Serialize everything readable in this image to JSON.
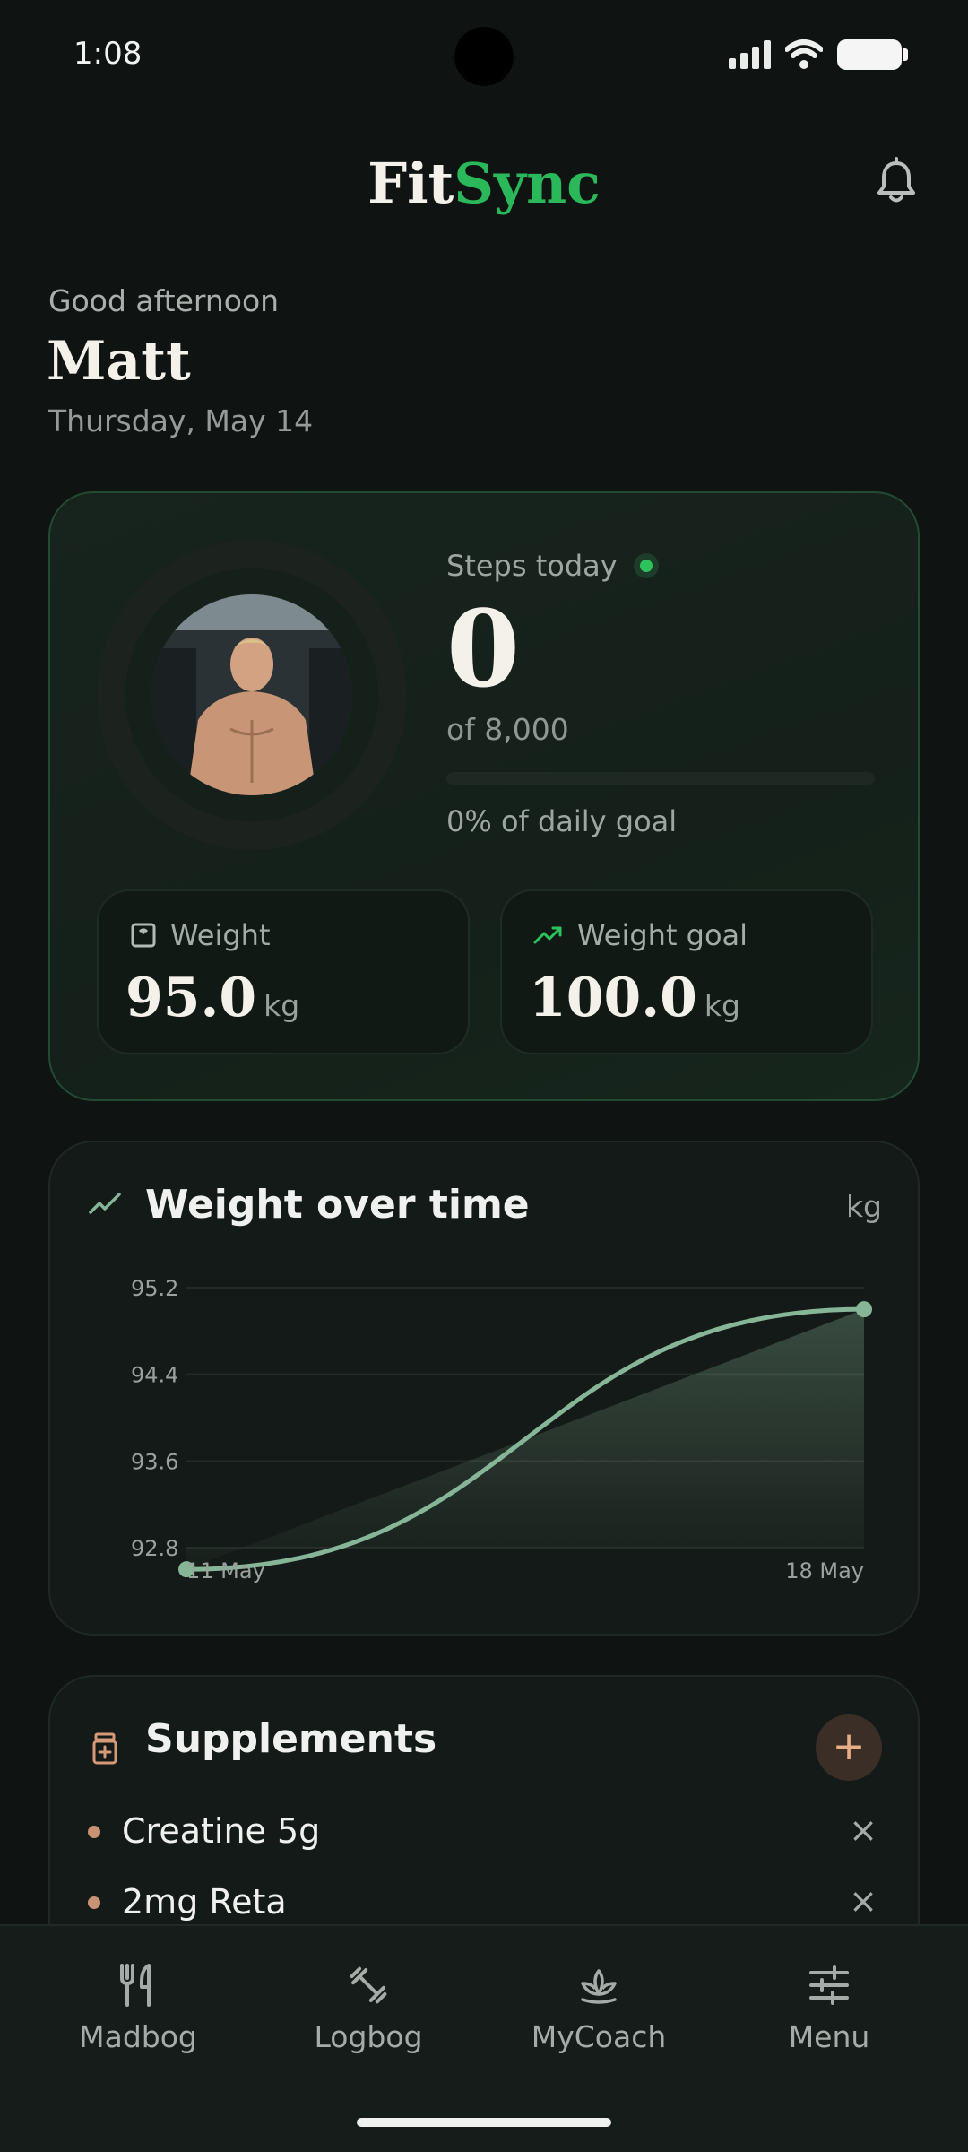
{
  "status_bar": {
    "time": "1:08"
  },
  "header": {
    "logo_part1": "Fit",
    "logo_part2": "Sync"
  },
  "greeting": {
    "salutation": "Good afternoon",
    "name": "Matt",
    "date": "Thursday, May 14"
  },
  "steps": {
    "label": "Steps today",
    "value": "0",
    "goal_text": "of 8,000",
    "progress_fraction": 0,
    "percent_text": "0% of daily goal"
  },
  "stats": {
    "weight": {
      "label": "Weight",
      "value": "95.0",
      "unit": "kg"
    },
    "weight_goal": {
      "label": "Weight goal",
      "value": "100.0",
      "unit": "kg"
    }
  },
  "weight_chart": {
    "title": "Weight over time",
    "unit_label": "kg",
    "accent_color": "#86b597"
  },
  "chart_data": {
    "type": "area",
    "title": "Weight over time",
    "xlabel": "",
    "ylabel": "kg",
    "x_tick_labels": [
      "11 May",
      "18 May"
    ],
    "y_tick_labels": [
      "95.2",
      "94.4",
      "93.6",
      "92.8"
    ],
    "ylim": [
      92.8,
      95.2
    ],
    "grid": true,
    "series": [
      {
        "x": [
          "11 May",
          "18 May"
        ],
        "values": [
          92.6,
          95.0
        ]
      }
    ]
  },
  "supplements": {
    "title": "Supplements",
    "add_label": "+",
    "remove_label": "×",
    "accent_color": "#c99373",
    "items": [
      {
        "name": "Creatine 5g"
      },
      {
        "name": "2mg Reta"
      }
    ]
  },
  "nav": {
    "items": [
      {
        "label": "Madbog",
        "icon": "utensils-icon"
      },
      {
        "label": "Logbog",
        "icon": "dumbbell-icon"
      },
      {
        "label": "MyCoach",
        "icon": "lotus-icon"
      },
      {
        "label": "Menu",
        "icon": "sliders-icon"
      }
    ]
  }
}
